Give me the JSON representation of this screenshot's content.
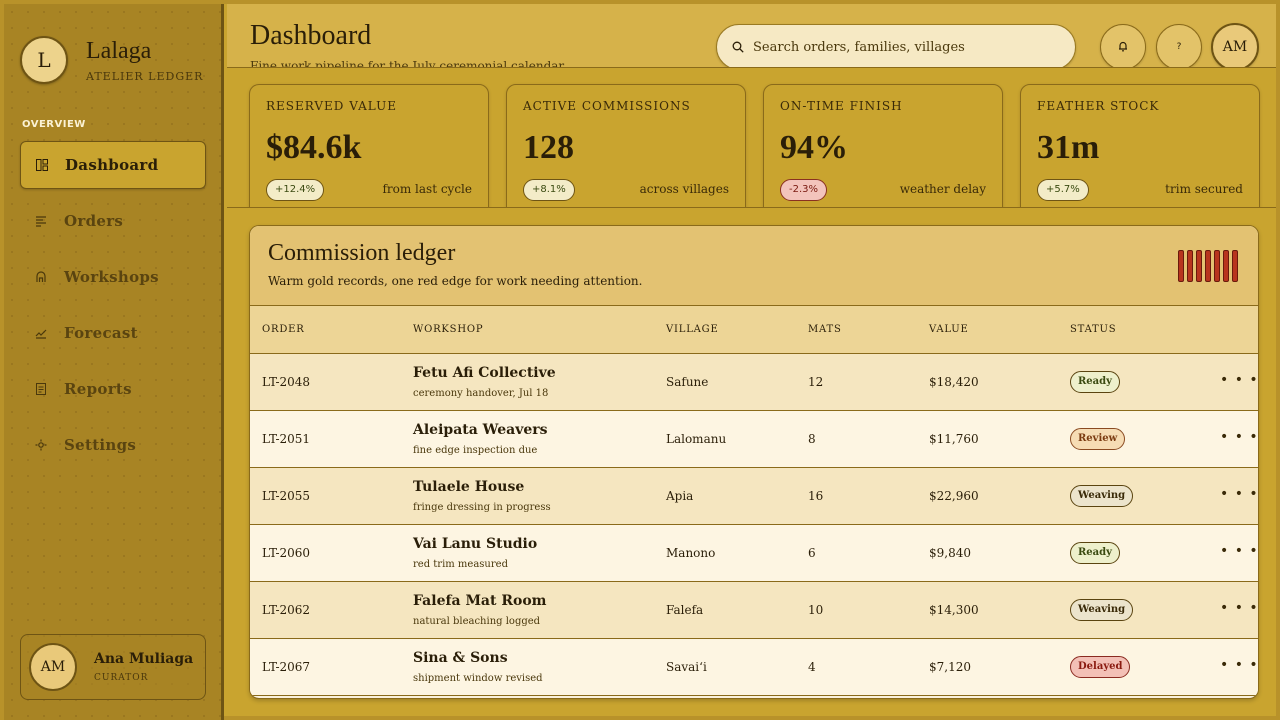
{
  "brand": {
    "initial": "L",
    "name": "Lalaga",
    "subtitle": "ATELIER LEDGER"
  },
  "nav": {
    "heading": "OVERVIEW",
    "items": [
      {
        "label": "Dashboard",
        "icon": "dashboard-icon",
        "active": true
      },
      {
        "label": "Orders",
        "icon": "list-icon",
        "active": false
      },
      {
        "label": "Workshops",
        "icon": "house-icon",
        "active": false
      },
      {
        "label": "Forecast",
        "icon": "trend-icon",
        "active": false
      },
      {
        "label": "Reports",
        "icon": "document-icon",
        "active": false
      },
      {
        "label": "Settings",
        "icon": "gear-icon",
        "active": false
      }
    ]
  },
  "user": {
    "initials": "AM",
    "name": "Ana Muliaga",
    "role": "CURATOR"
  },
  "header": {
    "title": "Dashboard",
    "subtitle": "Fine work pipeline for the July ceremonial calendar",
    "search_placeholder": "Search orders, families, villages",
    "avatar_initials": "AM",
    "help_glyph": "?"
  },
  "kpis": [
    {
      "label": "RESERVED VALUE",
      "value": "$84.6k",
      "change": "+12.4%",
      "note": "from last cycle",
      "negative": false
    },
    {
      "label": "ACTIVE COMMISSIONS",
      "value": "128",
      "change": "+8.1%",
      "note": "across villages",
      "negative": false
    },
    {
      "label": "ON-TIME FINISH",
      "value": "94%",
      "change": "-2.3%",
      "note": "weather delay",
      "negative": true
    },
    {
      "label": "FEATHER STOCK",
      "value": "31m",
      "change": "+5.7%",
      "note": "trim secured",
      "negative": false
    }
  ],
  "ledger": {
    "title": "Commission ledger",
    "subtitle": "Warm gold records, one red edge for work needing attention.",
    "columns": [
      "ORDER",
      "WORKSHOP",
      "VILLAGE",
      "MATS",
      "VALUE",
      "STATUS"
    ],
    "rows": [
      {
        "order": "LT-2048",
        "workshop": "Fetu Afi Collective",
        "note": "ceremony handover, Jul 18",
        "village": "Safune",
        "mats": "12",
        "value": "$18,420",
        "status": "Ready",
        "kind": "ready"
      },
      {
        "order": "LT-2051",
        "workshop": "Aleipata Weavers",
        "note": "fine edge inspection due",
        "village": "Lalomanu",
        "mats": "8",
        "value": "$11,760",
        "status": "Review",
        "kind": "review"
      },
      {
        "order": "LT-2055",
        "workshop": "Tulaele House",
        "note": "fringe dressing in progress",
        "village": "Apia",
        "mats": "16",
        "value": "$22,960",
        "status": "Weaving",
        "kind": "weaving"
      },
      {
        "order": "LT-2060",
        "workshop": "Vai Lanu Studio",
        "note": "red trim measured",
        "village": "Manono",
        "mats": "6",
        "value": "$9,840",
        "status": "Ready",
        "kind": "ready"
      },
      {
        "order": "LT-2062",
        "workshop": "Falefa Mat Room",
        "note": "natural bleaching logged",
        "village": "Falefa",
        "mats": "10",
        "value": "$14,300",
        "status": "Weaving",
        "kind": "weaving"
      },
      {
        "order": "LT-2067",
        "workshop": "Sina & Sons",
        "note": "shipment window revised",
        "village": "Savai‘i",
        "mats": "4",
        "value": "$7,120",
        "status": "Delayed",
        "kind": "delayed"
      }
    ],
    "more_glyph": "• • •"
  },
  "colors": {
    "accent": "#c9a42f",
    "sidebar": "#a88424",
    "alert": "#b8341e"
  }
}
